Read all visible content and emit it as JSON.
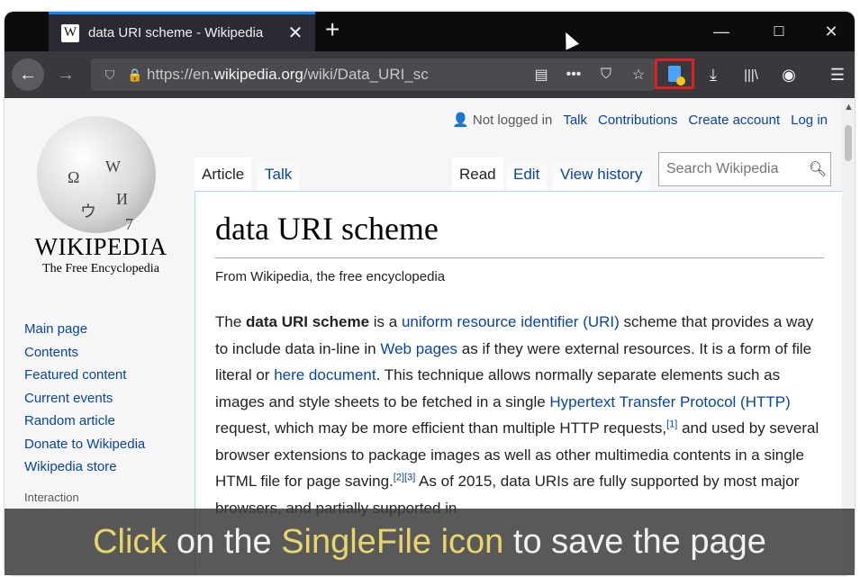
{
  "browser": {
    "tab": {
      "favicon": "W",
      "title": "data URI scheme - Wikipedia",
      "close": "✕"
    },
    "new_tab": "+",
    "window_controls": {
      "minimize": "—",
      "maximize": "☐",
      "close": "✕"
    },
    "url": {
      "prefix": "https://en.",
      "domain": "wikipedia.org",
      "path": "/wiki/Data_URI_sc"
    },
    "icons": {
      "back": "←",
      "forward": "→",
      "shield": "⛉",
      "lock": "🔒",
      "reader": "▤",
      "more": "•••",
      "pocket": "⛉",
      "bookmark": "☆",
      "download": "⤓",
      "library": "|||\\",
      "account": "◉",
      "menu": "☰"
    }
  },
  "wikipedia": {
    "globe_glyphs": [
      "Ω",
      "W",
      "И",
      "ウ",
      "7"
    ],
    "wordmark": "WIKIPEDIA",
    "tagline": "The Free Encyclopedia",
    "nav": [
      "Main page",
      "Contents",
      "Featured content",
      "Current events",
      "Random article",
      "Donate to Wikipedia",
      "Wikipedia store"
    ],
    "nav_section": "Interaction",
    "personal": {
      "not_logged_in": "Not logged in",
      "talk": "Talk",
      "contributions": "Contributions",
      "create_account": "Create account",
      "log_in": "Log in"
    },
    "tabs": {
      "article": "Article",
      "talk": "Talk",
      "read": "Read",
      "edit": "Edit",
      "view_history": "View history"
    },
    "search_placeholder": "Search Wikipedia",
    "article": {
      "title": "data URI scheme",
      "from": "From Wikipedia, the free encyclopedia",
      "p": {
        "t1": "The ",
        "b1": "data URI scheme",
        "t2": " is a ",
        "l1": "uniform resource identifier (URI)",
        "t3": " scheme that provides a way to include data in-line in ",
        "l2": "Web pages",
        "t4": " as if they were external resources. It is a form of file literal or ",
        "l3": "here document",
        "t5": ". This technique allows normally separate elements such as images and style sheets to be fetched in a single ",
        "l4": "Hypertext Transfer Protocol (HTTP)",
        "t6": " request, which may be more efficient than multiple HTTP requests,",
        "r1": "[1]",
        "t7": " and used by several browser extensions to package images as well as other multimedia contents in a single HTML file for page saving.",
        "r2": "[2][3]",
        "t8": " As of 2015, data URIs are fully supported by most major browsers, and partially supported in"
      }
    }
  },
  "caption": {
    "w1": "Click",
    "t1": " on the ",
    "w2": "SingleFile icon",
    "t2": " to save the page"
  },
  "colors": {
    "link": "#0645ad",
    "highlight_box": "#e02020",
    "caption_highlight": "#e9d66b",
    "tab_accent": "#0a84ff"
  }
}
